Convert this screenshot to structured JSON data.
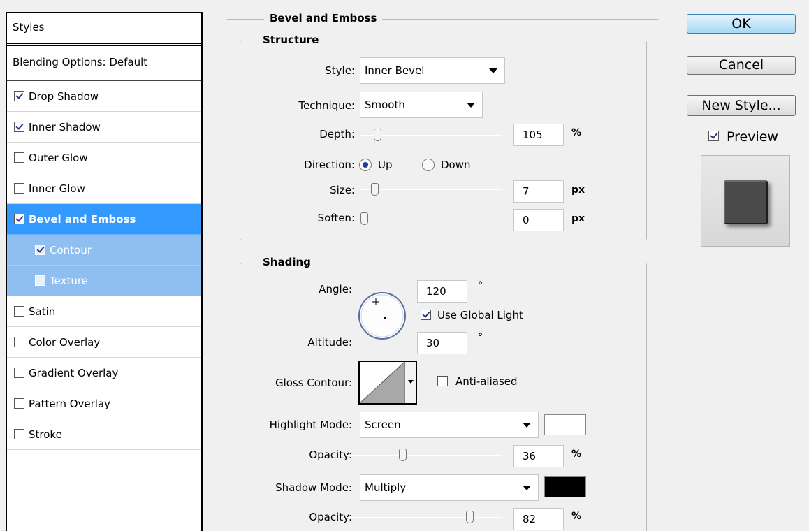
{
  "styles_panel": {
    "header": "Styles",
    "blending": "Blending Options: Default",
    "items": [
      {
        "label": "Drop Shadow",
        "checked": true
      },
      {
        "label": "Inner Shadow",
        "checked": true
      },
      {
        "label": "Outer Glow",
        "checked": false
      },
      {
        "label": "Inner Glow",
        "checked": false
      },
      {
        "label": "Bevel and Emboss",
        "checked": true
      },
      {
        "label": "Contour",
        "checked": true
      },
      {
        "label": "Texture",
        "checked": false
      },
      {
        "label": "Satin",
        "checked": false
      },
      {
        "label": "Color Overlay",
        "checked": false
      },
      {
        "label": "Gradient Overlay",
        "checked": false
      },
      {
        "label": "Pattern Overlay",
        "checked": false
      },
      {
        "label": "Stroke",
        "checked": false
      }
    ]
  },
  "bevel": {
    "title": "Bevel and Emboss",
    "structure": {
      "title": "Structure",
      "style_label": "Style:",
      "style_value": "Inner Bevel",
      "technique_label": "Technique:",
      "technique_value": "Smooth",
      "depth_label": "Depth:",
      "depth_value": "105",
      "depth_unit": "%",
      "direction_label": "Direction:",
      "direction_up": "Up",
      "direction_down": "Down",
      "direction_selected": "Up",
      "size_label": "Size:",
      "size_value": "7",
      "size_unit": "px",
      "soften_label": "Soften:",
      "soften_value": "0",
      "soften_unit": "px"
    },
    "shading": {
      "title": "Shading",
      "angle_label": "Angle:",
      "angle_value": "120",
      "angle_unit": "°",
      "global_light_label": "Use Global Light",
      "global_light_checked": true,
      "altitude_label": "Altitude:",
      "altitude_value": "30",
      "altitude_unit": "°",
      "gloss_label": "Gloss Contour:",
      "anti_aliased_label": "Anti-aliased",
      "anti_aliased_checked": false,
      "highlight_label": "Highlight Mode:",
      "highlight_value": "Screen",
      "highlight_color": "#ffffff",
      "highlight_opacity_label": "Opacity:",
      "highlight_opacity_value": "36",
      "highlight_opacity_unit": "%",
      "shadow_label": "Shadow Mode:",
      "shadow_value": "Multiply",
      "shadow_color": "#000000",
      "shadow_opacity_label": "Opacity:",
      "shadow_opacity_value": "82",
      "shadow_opacity_unit": "%"
    }
  },
  "buttons": {
    "ok": "OK",
    "cancel": "Cancel",
    "new_style": "New Style...",
    "preview_label": "Preview",
    "preview_checked": true
  },
  "colors": {
    "selected_row": "#3399ff",
    "sub_selected_row": "#8fbef0",
    "preview_square": "#4a4a4a"
  },
  "slider_levels": {
    "depth": 0.1,
    "size": 0.08,
    "soften": 0.0,
    "highlight_opacity": 0.36,
    "shadow_opacity": 0.82
  }
}
